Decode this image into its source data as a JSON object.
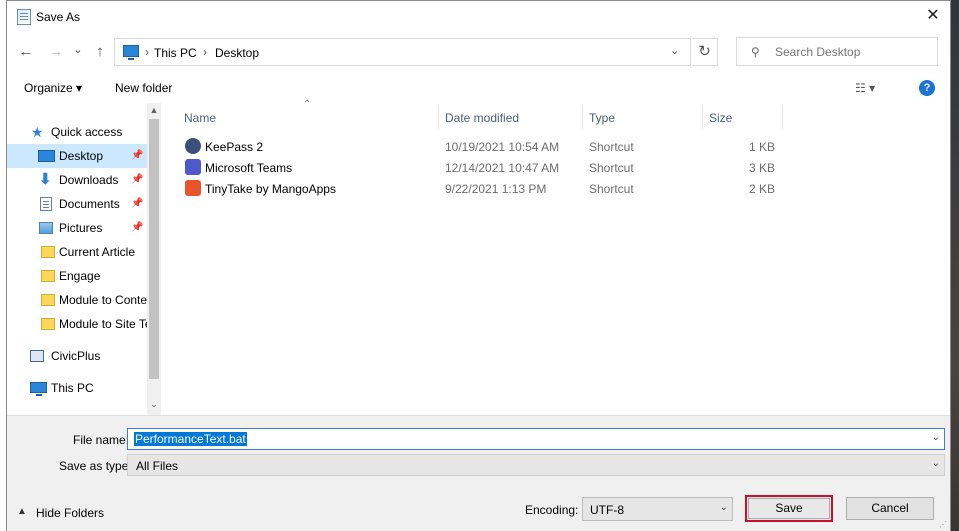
{
  "window": {
    "title": "Save As"
  },
  "nav": {
    "back": "←",
    "forward": "→",
    "history": "⌄",
    "up": "↑",
    "refresh": "↻"
  },
  "address": {
    "crumbs": [
      "This PC",
      "Desktop"
    ],
    "separator": "›",
    "dropdown": "⌄"
  },
  "search": {
    "placeholder": "Search Desktop"
  },
  "toolbar": {
    "organize": "Organize ▾",
    "new_folder": "New folder",
    "view": "☷ ▾",
    "help": "?"
  },
  "sidebar": {
    "items": [
      {
        "label": "Quick access"
      },
      {
        "label": "Desktop",
        "pinned": true
      },
      {
        "label": "Downloads",
        "pinned": true
      },
      {
        "label": "Documents",
        "pinned": true
      },
      {
        "label": "Pictures",
        "pinned": true
      },
      {
        "label": "Current Article"
      },
      {
        "label": "Engage"
      },
      {
        "label": "Module to Content"
      },
      {
        "label": "Module to Site Text"
      },
      {
        "label": "CivicPlus"
      },
      {
        "label": "This PC"
      }
    ],
    "pin_glyph": "📌"
  },
  "columns": {
    "name": "Name",
    "date": "Date modified",
    "type": "Type",
    "size": "Size"
  },
  "files": [
    {
      "name": "KeePass 2",
      "date": "10/19/2021 10:54 AM",
      "type": "Shortcut",
      "size": "1 KB",
      "icon": "keepass-icon",
      "color": "#3b4f7a"
    },
    {
      "name": "Microsoft Teams",
      "date": "12/14/2021 10:47 AM",
      "type": "Shortcut",
      "size": "3 KB",
      "icon": "teams-icon",
      "color": "#5059c9"
    },
    {
      "name": "TinyTake by MangoApps",
      "date": "9/22/2021 1:13 PM",
      "type": "Shortcut",
      "size": "2 KB",
      "icon": "tinytake-icon",
      "color": "#e8542b"
    }
  ],
  "form": {
    "file_name_label": "File name:",
    "file_name_value": "PerformanceText.bat",
    "save_as_type_label": "Save as type:",
    "save_as_type_value": "All Files",
    "encoding_label": "Encoding:",
    "encoding_value": "UTF-8",
    "hide_folders": "Hide Folders",
    "save": "Save",
    "cancel": "Cancel"
  },
  "colors": {
    "selection": "#cce8ff",
    "accent": "#0078d7",
    "highlight_border": "#c8102e"
  }
}
